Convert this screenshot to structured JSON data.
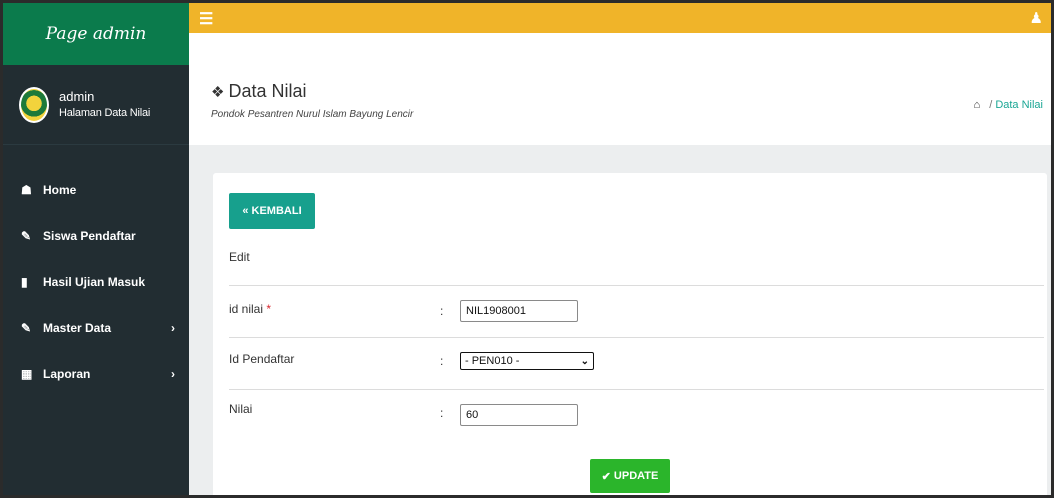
{
  "sidebar": {
    "brand": "Page admin",
    "user": {
      "name": "admin",
      "subtitle": "Halaman Data Nilai"
    },
    "items": [
      {
        "label": "Home",
        "icon": "home-icon"
      },
      {
        "label": "Siswa Pendaftar",
        "icon": "pencil-icon"
      },
      {
        "label": "Hasil Ujian Masuk",
        "icon": "book-icon"
      },
      {
        "label": "Master Data",
        "icon": "edit-icon",
        "has_children": true
      },
      {
        "label": "Laporan",
        "icon": "calendar-icon",
        "has_children": true
      }
    ]
  },
  "topbar": {
    "menu_icon": "hamburger-icon",
    "user_icon": "user-icon"
  },
  "header": {
    "title": "Data Nilai",
    "subtitle": "Pondok Pesantren Nurul Islam Bayung Lencir",
    "breadcrumb": {
      "current": "Data Nilai"
    }
  },
  "form": {
    "back_label": "KEMBALI",
    "section_label": "Edit",
    "fields": {
      "id_nilai": {
        "label": "id nilai",
        "required_mark": "*",
        "value": "NIL1908001"
      },
      "id_pendaftar": {
        "label": "Id Pendaftar",
        "value": "- PEN010 -"
      },
      "nilai": {
        "label": "Nilai",
        "value": "60"
      }
    },
    "colon": ":",
    "update_label": "UPDATE"
  },
  "colors": {
    "brand_green": "#0b7b4c",
    "topbar_yellow": "#f0b429",
    "sidebar_dark": "#222d32",
    "teal_button": "#17a08d",
    "update_green": "#2bb52b"
  }
}
